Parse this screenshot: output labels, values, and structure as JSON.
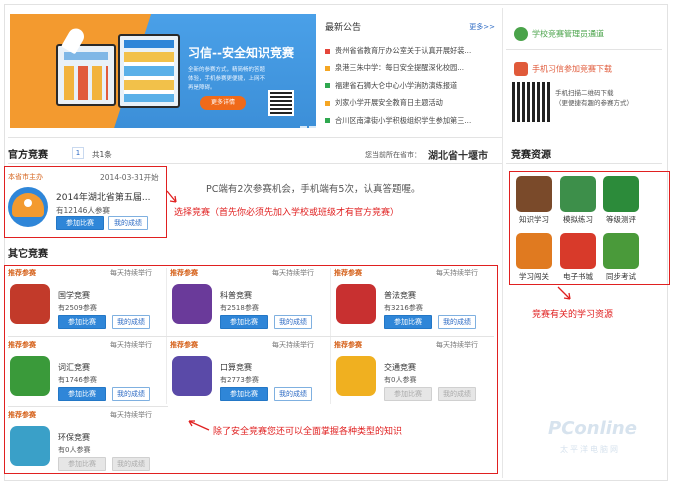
{
  "banner": {
    "title": "习信--安全知识竞赛",
    "desc": "全新的参赛方式，精简畅的答题体验，手机参赛更便捷，上网不再是障碍。",
    "more_button": "更多详情"
  },
  "news": {
    "title": "最新公告",
    "more": "更多>>",
    "items": [
      {
        "text": "贵州省省教育厅办公室关于认真开展好装...",
        "color": "#e5463a"
      },
      {
        "text": "泉港三朱中学：每日安全提醒深化校园...",
        "color": "#f5a623"
      },
      {
        "text": "福建省石狮大仑中心小学消防演练报道",
        "color": "#2fa84f"
      },
      {
        "text": "刘家小学开展安全教育日主题活动",
        "color": "#f5a623"
      },
      {
        "text": "合川区南津街小学积极组织学生参加第三...",
        "color": "#2fa84f"
      }
    ]
  },
  "sidebar": {
    "admin_link": "学校竞赛管理员通道",
    "mobile_link": "手机习信参加竞赛下载",
    "qr_text_1": "手机扫描二维码下载",
    "qr_text_2": "（更便捷有趣的参赛方式）",
    "resources_title": "竞赛资源",
    "resources": [
      {
        "label": "知识学习",
        "color": "#7a4a2a"
      },
      {
        "label": "模拟练习",
        "color": "#3d8f4a"
      },
      {
        "label": "等级测评",
        "color": "#2c8b3a"
      },
      {
        "label": "学习闯关",
        "color": "#e07a20"
      },
      {
        "label": "电子书城",
        "color": "#d83a2a"
      },
      {
        "label": "同步考试",
        "color": "#4a9a3a"
      }
    ],
    "resources_note": "竞赛有关的学习资源"
  },
  "official": {
    "title": "官方竞赛",
    "page": "1",
    "total": "共1条",
    "location_label": "您当前所在省市：",
    "location": "湖北省十堰市",
    "card": {
      "tag": "本省市主办",
      "date": "2014-03-31开始",
      "name": "2014年湖北省第五届...",
      "count": "有12146人参赛",
      "join": "参加比赛",
      "mine": "我的成绩"
    },
    "note": "PC端有2次参赛机会，手机端有5次，认真答题喔。",
    "annotation": "选择竞赛（首先你必须先加入学校或班级才有官方竞赛）"
  },
  "others": {
    "title": "其它竞赛",
    "every_day": "每天持续举行",
    "tag": "推荐参赛",
    "join": "参加比赛",
    "mine": "我的成绩",
    "items": [
      {
        "name": "国学竞赛",
        "count": "有2509参赛",
        "enabled": true
      },
      {
        "name": "科普竞赛",
        "count": "有2518参赛",
        "enabled": true
      },
      {
        "name": "普法竞赛",
        "count": "有3216参赛",
        "enabled": true
      },
      {
        "name": "词汇竞赛",
        "count": "有1746参赛",
        "enabled": true
      },
      {
        "name": "口算竞赛",
        "count": "有2773参赛",
        "enabled": true
      },
      {
        "name": "交通竞赛",
        "count": "有0人参赛",
        "enabled": false
      },
      {
        "name": "环保竞赛",
        "count": "有0人参赛",
        "enabled": false
      }
    ],
    "annotation": "除了安全竞赛您还可以全面掌握各种类型的知识"
  },
  "watermark": "PConline",
  "watermark_sub": "太平洋电脑网"
}
